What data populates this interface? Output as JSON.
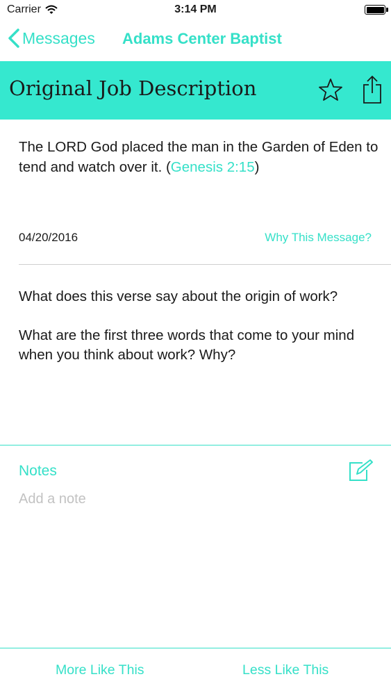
{
  "status_bar": {
    "carrier": "Carrier",
    "time": "3:14 PM",
    "icons": {
      "wifi": "wifi-icon",
      "battery": "battery-icon"
    }
  },
  "nav": {
    "back_label": "Messages",
    "title": "Adams Center Baptist",
    "icons": {
      "back": "chevron-left-icon"
    }
  },
  "message": {
    "title": "Original Job Description",
    "verse_text": "The LORD God placed the man in the Garden of Eden to tend and watch over it. (",
    "verse_ref": "Genesis 2:15",
    "verse_close": ")",
    "date": "04/20/2016",
    "why_link": "Why This Message?",
    "questions": [
      "What does this verse say about the origin of work?",
      "What are the first three words that come to your mind when you think about work? Why?"
    ],
    "icons": {
      "favorite": "star-icon",
      "share": "share-icon"
    }
  },
  "notes": {
    "label": "Notes",
    "placeholder": "Add a note",
    "value": "",
    "icons": {
      "edit": "edit-note-icon"
    }
  },
  "footer": {
    "more_label": "More Like This",
    "less_label": "Less Like This"
  },
  "colors": {
    "accent": "#35e0c8",
    "banner": "#35e8cf",
    "text": "#1a1a1a",
    "placeholder": "#c2c2c2",
    "divider": "#cfcfcf"
  }
}
